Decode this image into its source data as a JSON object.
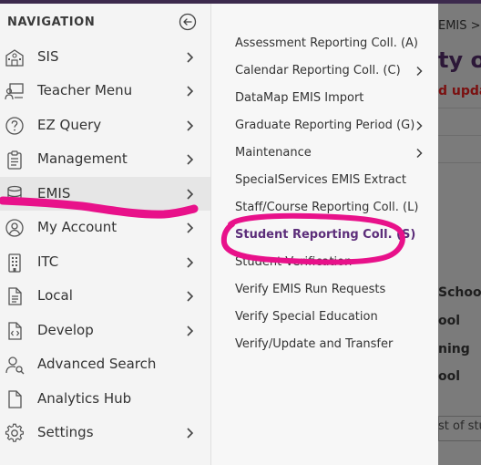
{
  "nav": {
    "header": "NAVIGATION",
    "items": [
      {
        "label": "SIS",
        "icon": "school-icon",
        "chevron": true
      },
      {
        "label": "Teacher Menu",
        "icon": "teacher-icon",
        "chevron": true
      },
      {
        "label": "EZ Query",
        "icon": "question-icon",
        "chevron": true
      },
      {
        "label": "Management",
        "icon": "clipboard-icon",
        "chevron": true
      },
      {
        "label": "EMIS",
        "icon": "database-icon",
        "chevron": true
      },
      {
        "label": "My Account",
        "icon": "user-icon",
        "chevron": true
      },
      {
        "label": "ITC",
        "icon": "building-icon",
        "chevron": true
      },
      {
        "label": "Local",
        "icon": "document-icon",
        "chevron": true
      },
      {
        "label": "Develop",
        "icon": "code-file-icon",
        "chevron": true
      },
      {
        "label": "Advanced Search",
        "icon": "user-search-icon",
        "chevron": false
      },
      {
        "label": "Analytics Hub",
        "icon": "file-icon",
        "chevron": false
      },
      {
        "label": "Settings",
        "icon": "gear-icon",
        "chevron": true
      }
    ],
    "active_item": "EMIS"
  },
  "submenu": {
    "items": [
      {
        "label": "Assessment Reporting Coll. (A)",
        "chevron": false
      },
      {
        "label": "Calendar Reporting Coll. (C)",
        "chevron": true
      },
      {
        "label": "DataMap EMIS Import",
        "chevron": false
      },
      {
        "label": "Graduate Reporting Period (G)",
        "chevron": true
      },
      {
        "label": "Maintenance",
        "chevron": true
      },
      {
        "label": "SpecialServices EMIS Extract",
        "chevron": false
      },
      {
        "label": "Staff/Course Reporting Coll. (L)",
        "chevron": false
      },
      {
        "label": "Student Reporting Coll. (S)",
        "chevron": false
      },
      {
        "label": "Student Verification",
        "chevron": false
      },
      {
        "label": "Verify EMIS Run Requests",
        "chevron": false
      },
      {
        "label": "Verify Special Education",
        "chevron": false
      },
      {
        "label": "Verify/Update and Transfer",
        "chevron": false
      }
    ],
    "highlighted_item": "Student Reporting Coll. (S)"
  },
  "background_page": {
    "breadcrumb": "EMIS >",
    "title": "ty of",
    "alert": "d upda",
    "rows": [
      "School",
      "ool",
      "ning",
      "ool"
    ],
    "footer": "st of stu"
  },
  "colors": {
    "annotation": "#e8118a",
    "accent": "#5c2d7a",
    "topbar": "#3c2a4d"
  }
}
